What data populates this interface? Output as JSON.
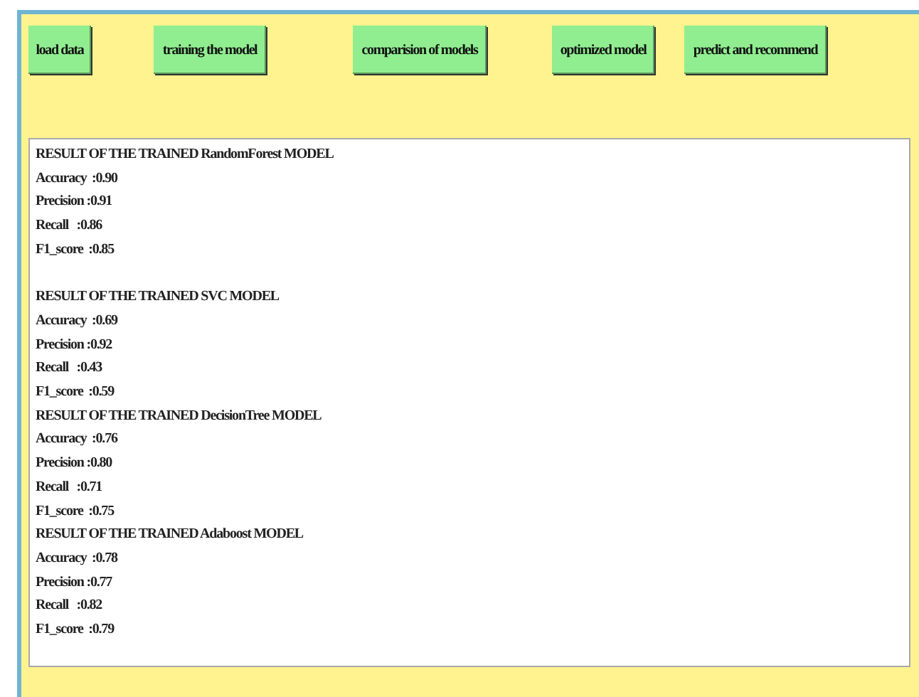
{
  "buttons": [
    {
      "label": "load data"
    },
    {
      "label": "training the model"
    },
    {
      "label": "comparision of models"
    },
    {
      "label": "optimized model"
    },
    {
      "label": "predict and recommend"
    }
  ],
  "results": [
    {
      "title": "RESULT OF THE TRAINED RandomForest MODEL",
      "lines": [
        "Accuracy  :0.90",
        "Precision :0.91",
        "Recall   :0.86",
        "F1_score  :0.85"
      ],
      "gap_after": true
    },
    {
      "title": "RESULT OF THE TRAINED SVC MODEL",
      "lines": [
        "Accuracy  :0.69",
        "Precision :0.92",
        "Recall   :0.43",
        "F1_score  :0.59"
      ],
      "gap_after": false
    },
    {
      "title": "RESULT OF THE TRAINED DecisionTree MODEL",
      "lines": [
        "Accuracy  :0.76",
        "Precision :0.80",
        "Recall   :0.71",
        "F1_score  :0.75"
      ],
      "gap_after": false
    },
    {
      "title": "RESULT OF THE TRAINED Adaboost MODEL",
      "lines": [
        "Accuracy  :0.78",
        "Precision :0.77",
        "Recall   :0.82",
        "F1_score  :0.79"
      ],
      "gap_after": false
    }
  ]
}
